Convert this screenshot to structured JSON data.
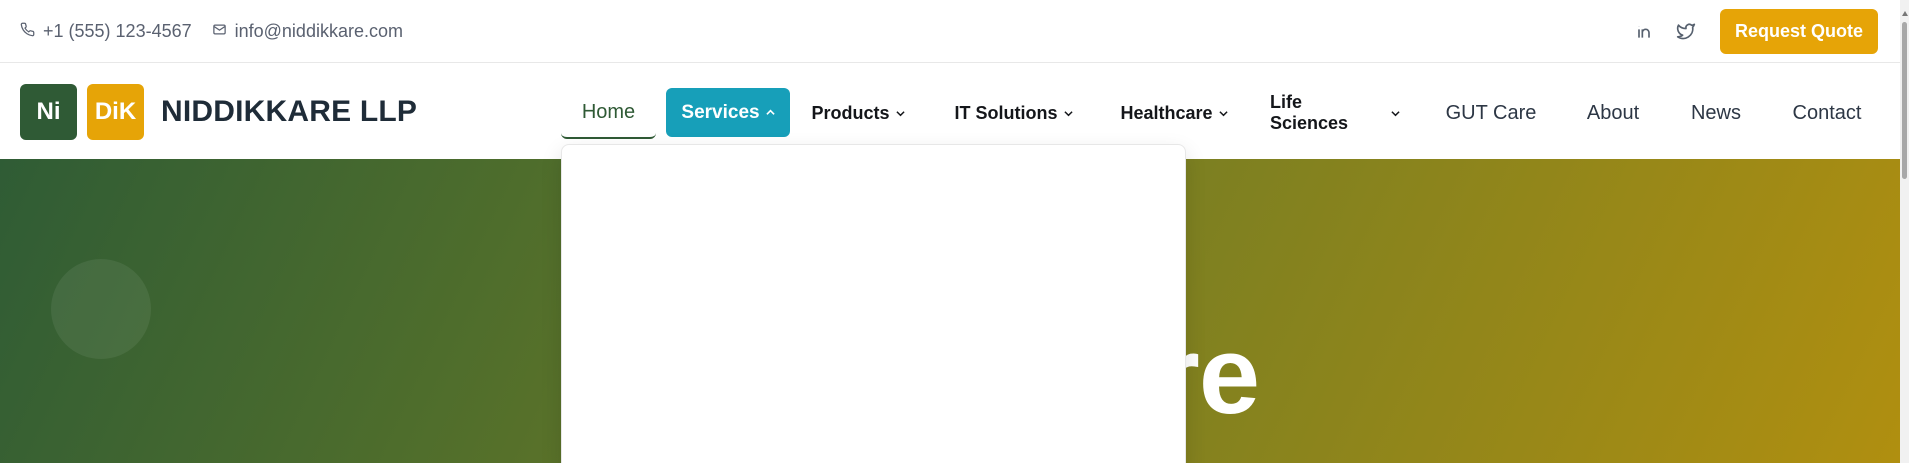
{
  "topbar": {
    "phone": "+1 (555) 123-4567",
    "email": "info@niddikkare.com",
    "social": [
      "linkedin-icon",
      "twitter-icon"
    ],
    "quote_button": "Request Quote"
  },
  "brand": {
    "logo_left": "Ni",
    "logo_right": "DiK",
    "name": "NIDDIKKARE LLP"
  },
  "nav": {
    "items": [
      {
        "label": "Home",
        "dropdown": false,
        "active": true
      },
      {
        "label": "Services",
        "dropdown": true,
        "open": true
      },
      {
        "label": "Products",
        "dropdown": true
      },
      {
        "label": "IT Solutions",
        "dropdown": true
      },
      {
        "label": "Healthcare",
        "dropdown": true
      },
      {
        "label": "Life Sciences",
        "dropdown": true
      },
      {
        "label": "GUT Care",
        "dropdown": false
      },
      {
        "label": "About",
        "dropdown": false
      },
      {
        "label": "News",
        "dropdown": false
      },
      {
        "label": "Contact",
        "dropdown": false
      }
    ]
  },
  "hero": {
    "visible_title_fragment": "re"
  },
  "colors": {
    "primary_green": "#2f5a35",
    "accent_gold": "#e6a407",
    "services_teal": "#179fb9",
    "text_dark": "#1f2c38"
  }
}
